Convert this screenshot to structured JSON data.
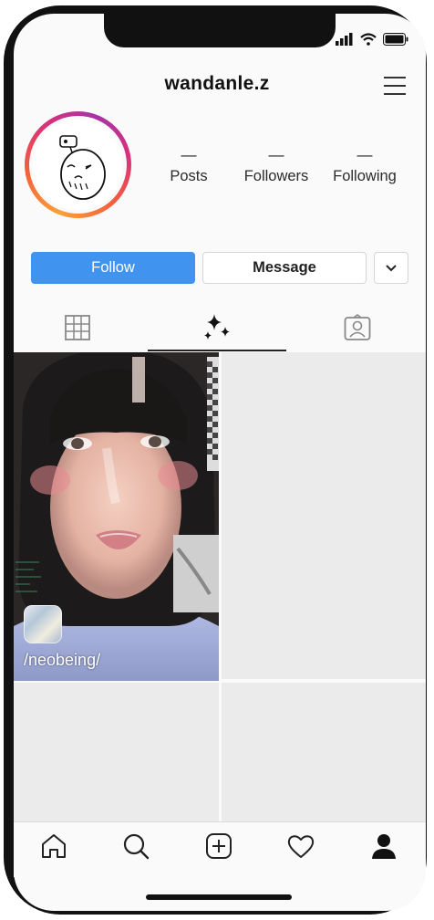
{
  "profile": {
    "username": "wandanle.z",
    "avatar_icon": "doodle-avatar"
  },
  "stats": [
    {
      "value": "—",
      "label": "Posts"
    },
    {
      "value": "—",
      "label": "Followers"
    },
    {
      "value": "—",
      "label": "Following"
    }
  ],
  "actions": {
    "follow_label": "Follow",
    "message_label": "Message",
    "more_icon": "chevron-down-icon"
  },
  "tabs": [
    {
      "name": "grid-icon",
      "active": false
    },
    {
      "name": "effects-icon",
      "active": true
    },
    {
      "name": "tagged-icon",
      "active": false
    }
  ],
  "post": {
    "effect_label": "/neobeing/"
  },
  "nav": [
    "home-icon",
    "search-icon",
    "create-icon",
    "heart-icon",
    "profile-icon"
  ],
  "colors": {
    "follow_button": "#4094f0",
    "tab_indicator": "#222222",
    "grid_placeholder": "#ebebeb"
  }
}
